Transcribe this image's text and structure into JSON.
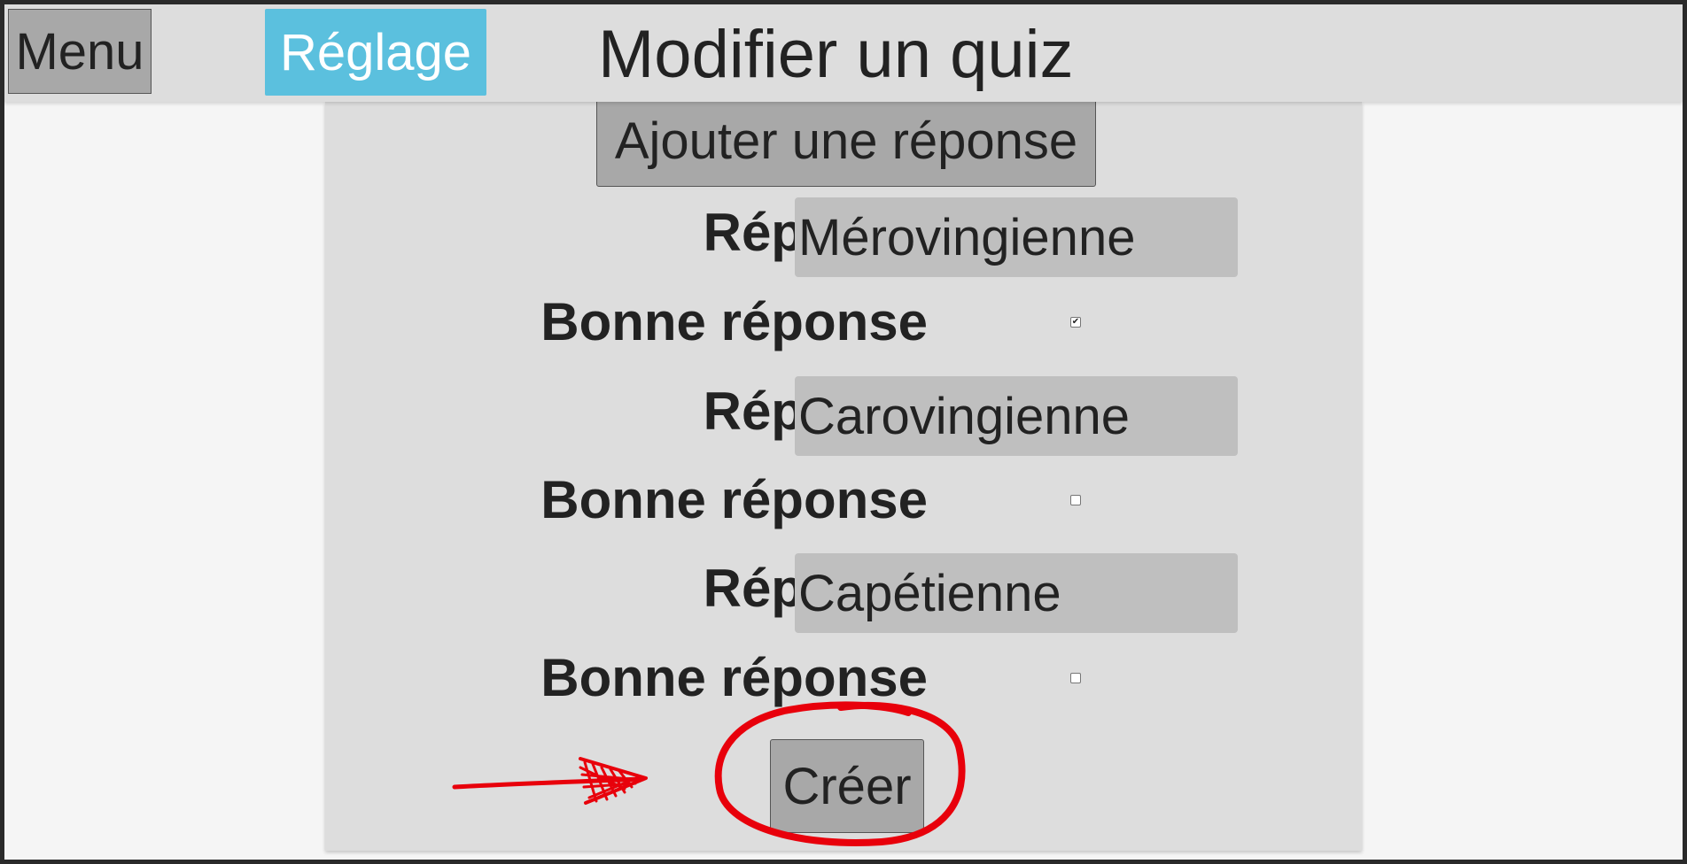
{
  "header": {
    "menu_label": "Menu",
    "settings_label": "Réglage",
    "title": "Modifier un quiz"
  },
  "form": {
    "add_answer_label": "Ajouter une réponse",
    "answer_label": "Réponse",
    "correct_label": "Bonne réponse",
    "answers": [
      {
        "value": "Mérovingienne",
        "correct": true
      },
      {
        "value": "Carovingienne",
        "correct": false
      },
      {
        "value": "Capétienne",
        "correct": false
      }
    ],
    "create_label": "Créer"
  },
  "colors": {
    "settings_button": "#5bc0de",
    "annotation": "#e8000b"
  },
  "annotation": {
    "shapes": [
      "arrow",
      "circle"
    ],
    "target": "create-button"
  }
}
